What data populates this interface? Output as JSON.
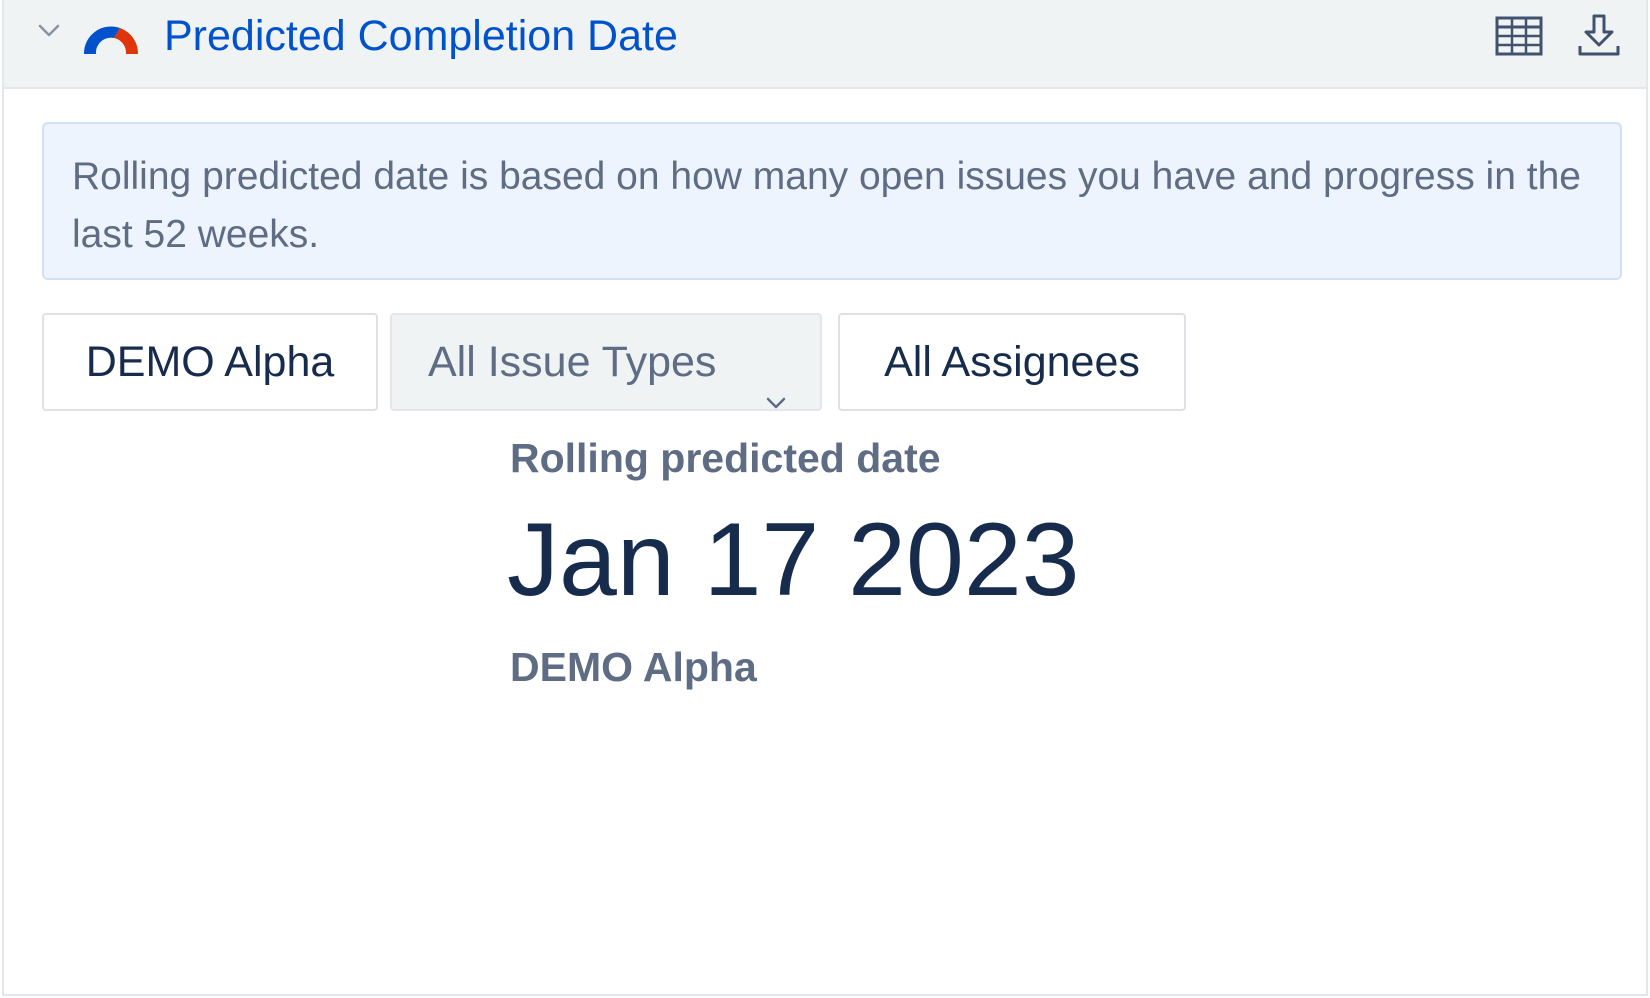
{
  "header": {
    "title": "Predicted Completion Date",
    "collapse_icon": "chevron-down-icon",
    "logo_icon": "gauge-logo-icon",
    "actions": [
      {
        "icon": "table-icon"
      },
      {
        "icon": "download-icon"
      }
    ]
  },
  "info": {
    "text": "Rolling predicted date is based on how many open issues you have and progress in the last 52 weeks."
  },
  "filters": {
    "project": "DEMO Alpha",
    "issue_types": "All Issue Types",
    "assignees": "All Assignees"
  },
  "result": {
    "label": "Rolling predicted date",
    "date": "Jan 17 2023",
    "project": "DEMO Alpha"
  },
  "colors": {
    "title": "#0052cc",
    "logo_blue": "#0052cc",
    "logo_red": "#de350b",
    "header_bg": "#f0f3f4",
    "info_bg": "#eef4fd",
    "date_text": "#172b4d",
    "muted_text": "#5e6c84"
  }
}
